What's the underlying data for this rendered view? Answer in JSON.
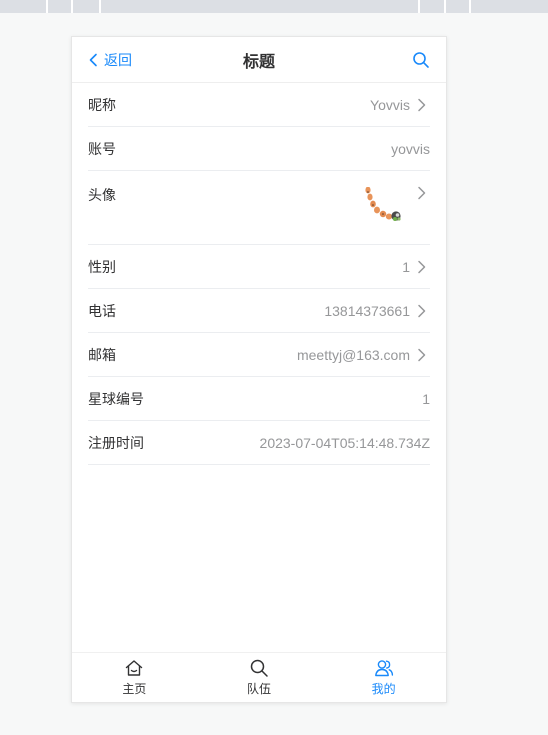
{
  "colors": {
    "accent": "#1989fa",
    "text": "#323233",
    "muted": "#969799"
  },
  "navbar": {
    "back_label": "返回",
    "back_icon": "chevron-left-icon",
    "title": "标题",
    "search_icon": "search-icon"
  },
  "profile": {
    "nickname": {
      "label": "昵称",
      "value": "Yovvis"
    },
    "account": {
      "label": "账号",
      "value": "yovvis"
    },
    "avatar": {
      "label": "头像",
      "icon": "avatar-image"
    },
    "gender": {
      "label": "性别",
      "value": "1"
    },
    "phone": {
      "label": "电话",
      "value": "13814373661"
    },
    "email": {
      "label": "邮箱",
      "value": "meettyj@163.com"
    },
    "planet_code": {
      "label": "星球编号",
      "value": "1"
    },
    "register_time": {
      "label": "注册时间",
      "value": "2023-07-04T05:14:48.734Z"
    }
  },
  "tabbar": {
    "home": {
      "label": "主页",
      "icon": "home-icon"
    },
    "team": {
      "label": "队伍",
      "icon": "search-icon"
    },
    "mine": {
      "label": "我的",
      "icon": "user-friends-icon",
      "active": true
    }
  }
}
